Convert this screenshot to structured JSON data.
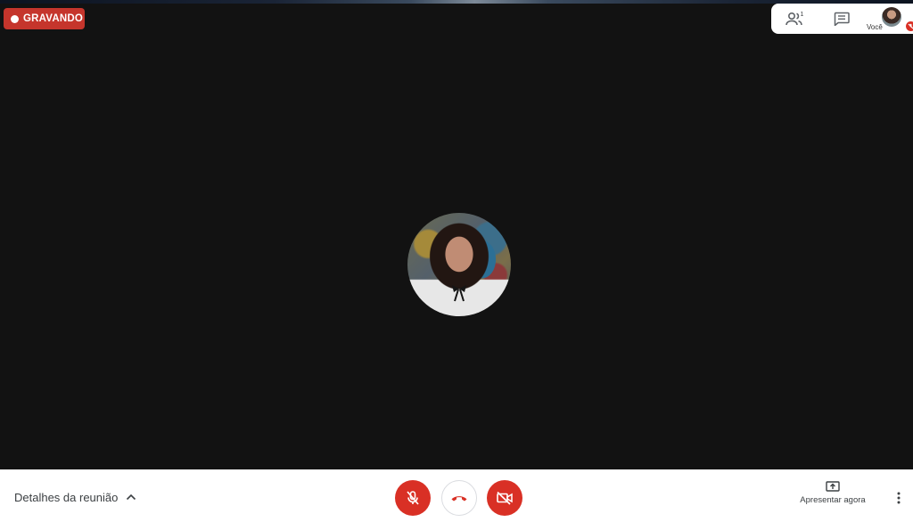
{
  "recording": {
    "label": "GRAVANDO",
    "color": "#c5352c"
  },
  "top_panel": {
    "participants_count": "1",
    "self_label": "Você",
    "icons": [
      "people-icon",
      "chat-icon",
      "mic-off-icon"
    ]
  },
  "meeting": {
    "details_label": "Detalhes da reunião",
    "participant": "participant-avatar"
  },
  "controls": {
    "mic_state": "off",
    "camera_state": "off",
    "accent_red": "#d93025",
    "icons": [
      "mic-off-icon",
      "hangup-icon",
      "camera-off-icon"
    ]
  },
  "present": {
    "label": "Apresentar agora",
    "icon": "present-screen-icon"
  },
  "more": {
    "icon": "more-vert-icon"
  }
}
